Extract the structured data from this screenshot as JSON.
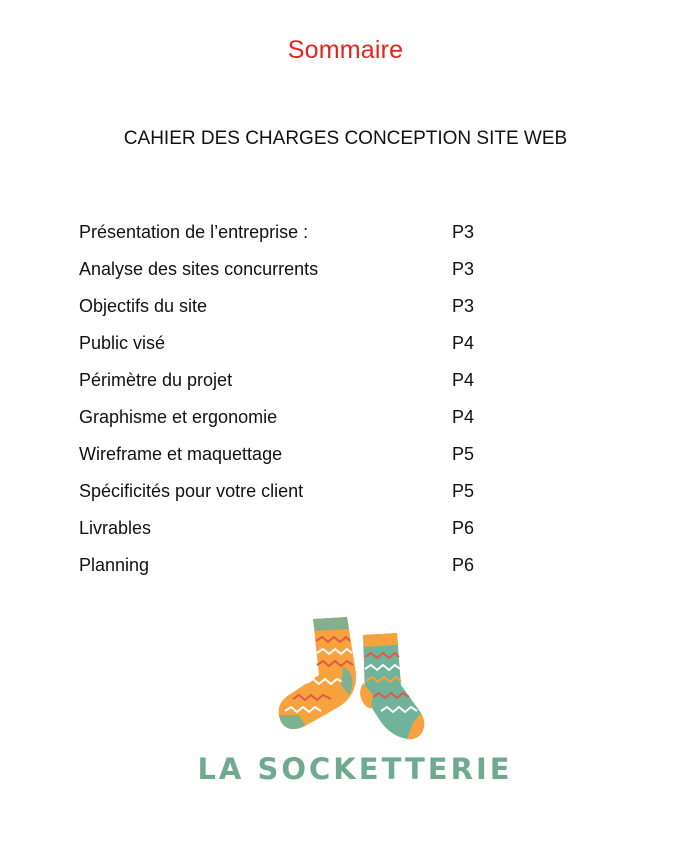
{
  "title": "Sommaire",
  "subtitle": "CAHIER DES CHARGES CONCEPTION SITE WEB",
  "toc": [
    {
      "label": "Présentation de l’entreprise :",
      "page": "P3"
    },
    {
      "label": "Analyse des sites concurrents",
      "page": "P3"
    },
    {
      "label": "Objectifs du site",
      "page": "P3"
    },
    {
      "label": "Public visé",
      "page": "P4"
    },
    {
      "label": "Périmètre du projet",
      "page": "P4"
    },
    {
      "label": "Graphisme et ergonomie",
      "page": "P4"
    },
    {
      "label": "Wireframe et maquettage",
      "page": "P5"
    },
    {
      "label": "Spécificités pour votre client",
      "page": "P5"
    },
    {
      "label": "Livrables",
      "page": "P6"
    },
    {
      "label": "Planning",
      "page": "P6"
    }
  ],
  "logo": {
    "brand_text": "LA SOCKETTERIE",
    "icon": "socks-icon",
    "colors": {
      "orange": "#f7a23c",
      "teal": "#6fb39a",
      "red_stripe": "#e05a4a",
      "brand_text": "#6fa98f"
    }
  },
  "colors": {
    "title": "#e8221b",
    "text": "#111111",
    "background": "#ffffff"
  }
}
